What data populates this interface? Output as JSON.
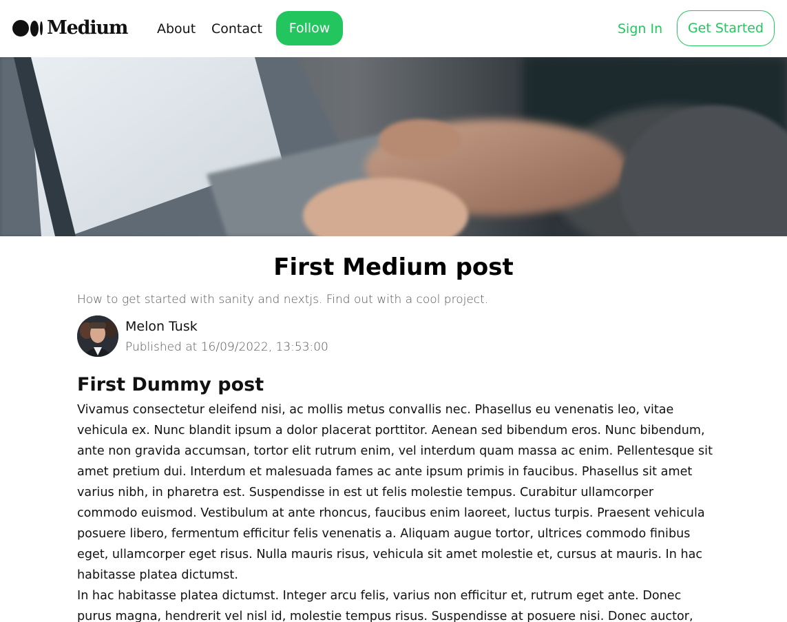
{
  "header": {
    "logo_text": "Medium",
    "nav": {
      "about": "About",
      "contact": "Contact",
      "follow": "Follow"
    },
    "sign_in": "Sign In",
    "get_started": "Get Started",
    "colors": {
      "accent": "#22c55e"
    }
  },
  "hero": {
    "icon": "hero-laptop-typing-image"
  },
  "article": {
    "title": "First Medium post",
    "subtitle": "How to get started with sanity and nextjs. Find out with a cool project.",
    "author": {
      "name": "Melon Tusk",
      "published": "Published at 16/09/2022, 13:53:00"
    },
    "post_heading": "First Dummy post",
    "paragraphs": [
      "Vivamus consectetur eleifend nisi, ac mollis metus convallis nec. Phasellus eu venenatis leo, vitae vehicula ex. Nunc blandit ipsum a dolor placerat porttitor. Aenean sed bibendum eros. Nunc bibendum, ante non gravida accumsan, tortor elit rutrum enim, vel interdum quam massa ac enim. Pellentesque sit amet pretium dui. Interdum et malesuada fames ac ante ipsum primis in faucibus. Phasellus sit amet varius nibh, in pharetra est. Suspendisse in est ut felis molestie tempus. Curabitur ullamcorper commodo euismod. Vestibulum at ante rhoncus, faucibus enim laoreet, luctus turpis. Praesent vehicula posuere libero, fermentum efficitur felis venenatis a. Aliquam augue tortor, ultrices commodo finibus eget, ullamcorper eget risus. Nulla mauris risus, vehicula sit amet molestie et, cursus at mauris. In hac habitasse platea dictumst.",
      "In hac habitasse platea dictumst. Integer arcu felis, varius non efficitur et, rutrum eget ante. Donec purus magna, hendrerit vel nisl id, molestie tempus risus. Suspendisse at posuere nisi. Donec auctor, arcu ac"
    ]
  }
}
